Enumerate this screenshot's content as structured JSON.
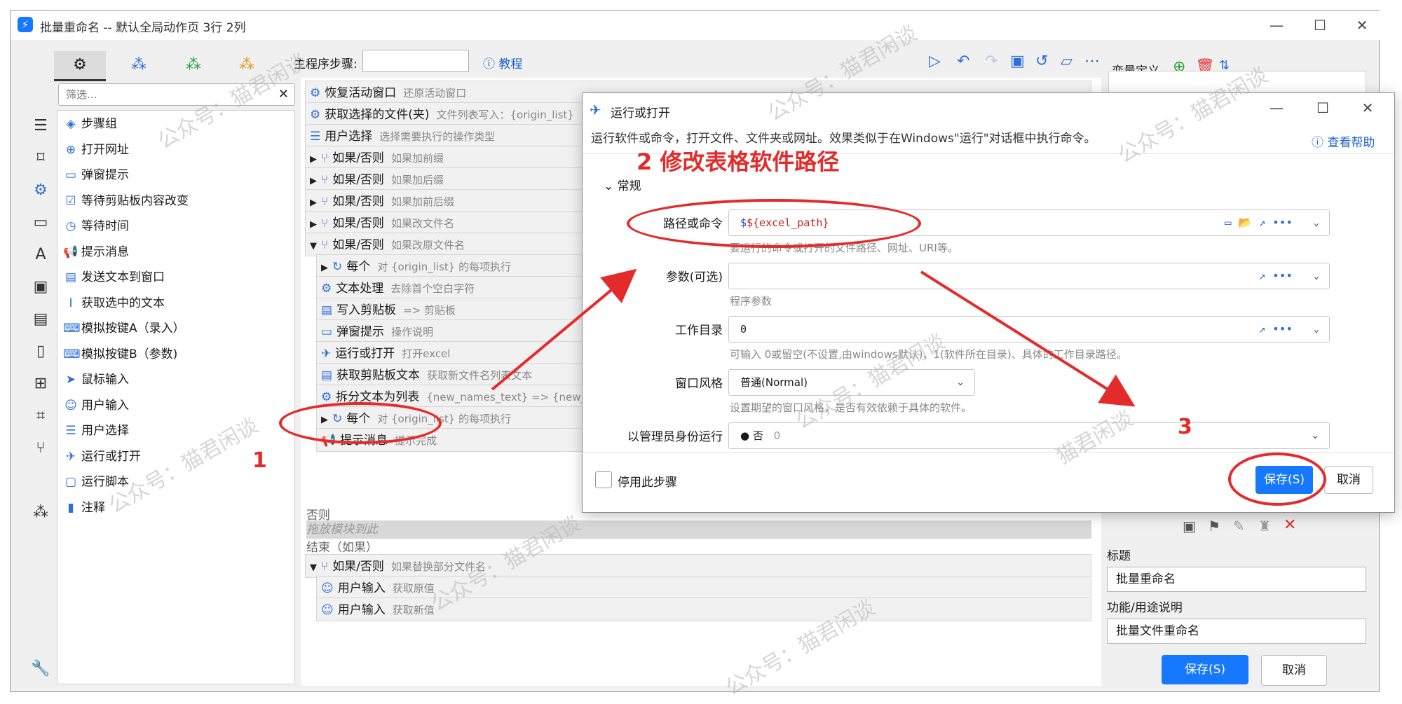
{
  "window": {
    "title": "批量重命名 -- 默认全局动作页 3行 2列",
    "min": "—",
    "max": "☐",
    "close": "✕"
  },
  "sidebar": {
    "filter_placeholder": "筛选...",
    "filter_clear": "✕",
    "library": [
      {
        "label": "步骤组",
        "icon": "layers-icon"
      },
      {
        "label": "打开网址",
        "icon": "globe-icon"
      },
      {
        "label": "弹窗提示",
        "icon": "popup-icon"
      },
      {
        "label": "等待剪贴板内容改变",
        "icon": "clipboard-check-icon"
      },
      {
        "label": "等待时间",
        "icon": "clock-icon"
      },
      {
        "label": "提示消息",
        "icon": "megaphone-icon"
      },
      {
        "label": "发送文本到窗口",
        "icon": "send-text-icon"
      },
      {
        "label": "获取选中的文本",
        "icon": "text-cursor-icon"
      },
      {
        "label": "模拟按键A（录入）",
        "icon": "keyboard-icon"
      },
      {
        "label": "模拟按键B（参数)",
        "icon": "keyboard-icon"
      },
      {
        "label": "鼠标输入",
        "icon": "mouse-pointer-icon"
      },
      {
        "label": "用户输入",
        "icon": "user-input-icon"
      },
      {
        "label": "用户选择",
        "icon": "list-select-icon"
      },
      {
        "label": "运行或打开",
        "icon": "paper-plane-icon"
      },
      {
        "label": "运行脚本",
        "icon": "script-icon"
      },
      {
        "label": "注释",
        "icon": "note-icon"
      }
    ]
  },
  "toolbar": {
    "main_steps_label": "主程序步骤:",
    "tutorial": "教程"
  },
  "steps": [
    {
      "name": "恢复活动窗口",
      "desc": "还原活动窗口",
      "indent": 0
    },
    {
      "name": "获取选择的文件(夹)",
      "desc": "文件列表写入：{origin_list}",
      "indent": 0
    },
    {
      "name": "用户选择",
      "desc": "选择需要执行的操作类型",
      "indent": 0
    },
    {
      "name": "如果/否则",
      "desc": "如果加前缀",
      "indent": 0
    },
    {
      "name": "如果/否则",
      "desc": "如果加后缀",
      "indent": 0
    },
    {
      "name": "如果/否则",
      "desc": "如果加前后缀",
      "indent": 0
    },
    {
      "name": "如果/否则",
      "desc": "如果改文件名",
      "indent": 0
    },
    {
      "name": "如果/否则",
      "desc": "如果改原文件名",
      "indent": 0
    },
    {
      "name": "每个",
      "desc": "对 {origin_list} 的每项执行",
      "indent": 1
    },
    {
      "name": "文本处理",
      "desc": "去除首个空白字符",
      "indent": 1
    },
    {
      "name": "写入剪贴板",
      "desc": "=> 剪贴板",
      "indent": 1
    },
    {
      "name": "弹窗提示",
      "desc": "操作说明",
      "indent": 1
    },
    {
      "name": "运行或打开",
      "desc": "打开excel",
      "indent": 1
    },
    {
      "name": "获取剪贴板文本",
      "desc": "获取新文件名列表文本",
      "indent": 1
    },
    {
      "name": "拆分文本为列表",
      "desc": "{new_names_text} => {new_nam",
      "indent": 1
    },
    {
      "name": "每个",
      "desc": "对 {origin_list} 的每项执行",
      "indent": 1
    },
    {
      "name": "提示消息",
      "desc": "提示完成",
      "indent": 1
    }
  ],
  "else_label": "否则",
  "drop_hint": "拖放模块到此",
  "end_label": "结束（如果）",
  "steps_after": [
    {
      "name": "如果/否则",
      "desc": "如果替换部分文件名",
      "indent": 0
    },
    {
      "name": "用户输入",
      "desc": "获取原值",
      "indent": 1
    },
    {
      "name": "用户输入",
      "desc": "获取新值",
      "indent": 1
    }
  ],
  "right_panel": {
    "var_title": "变量定义",
    "title_label": "标题",
    "title_value": "批量重命名",
    "desc_label": "功能/用途说明",
    "desc_value": "批量文件重命名",
    "save": "保存(S)",
    "cancel": "取消"
  },
  "dialog": {
    "title": "运行或打开",
    "subtitle": "运行软件或命令，打开文件、文件夹或网址。效果类似于在Windows\"运行\"对话框中执行命令。",
    "help": "查看帮助",
    "section": "常规",
    "path_label": "路径或命令",
    "path_value_prefix": "$",
    "path_value_var": "${excel_path}",
    "path_hint": "要运行的命令或打开的文件路径、网址、URI等。",
    "args_label": "参数(可选)",
    "args_value": "",
    "args_hint": "程序参数",
    "workdir_label": "工作目录",
    "workdir_value": "0",
    "workdir_hint": "可输入 0或留空(不设置,由windows默认)、1(软件所在目录)、具体的工作目录路径。",
    "winstyle_label": "窗口风格",
    "winstyle_value": "普通(Normal)",
    "winstyle_hint": "设置期望的窗口风格，是否有效依赖于具体的软件。",
    "admin_label": "以管理员身份运行",
    "admin_value": "● 否",
    "admin_code": "0",
    "disable_step": "停用此步骤",
    "save": "保存(S)",
    "cancel": "取消"
  },
  "annotations": {
    "step2": "2 修改表格软件路径",
    "num1": "1",
    "num3": "3"
  },
  "watermarks": [
    "公众号：猫君闲谈",
    "猫君闲谈"
  ],
  "colors": {
    "accent": "#1677ff",
    "annotation": "#e32b2b"
  }
}
